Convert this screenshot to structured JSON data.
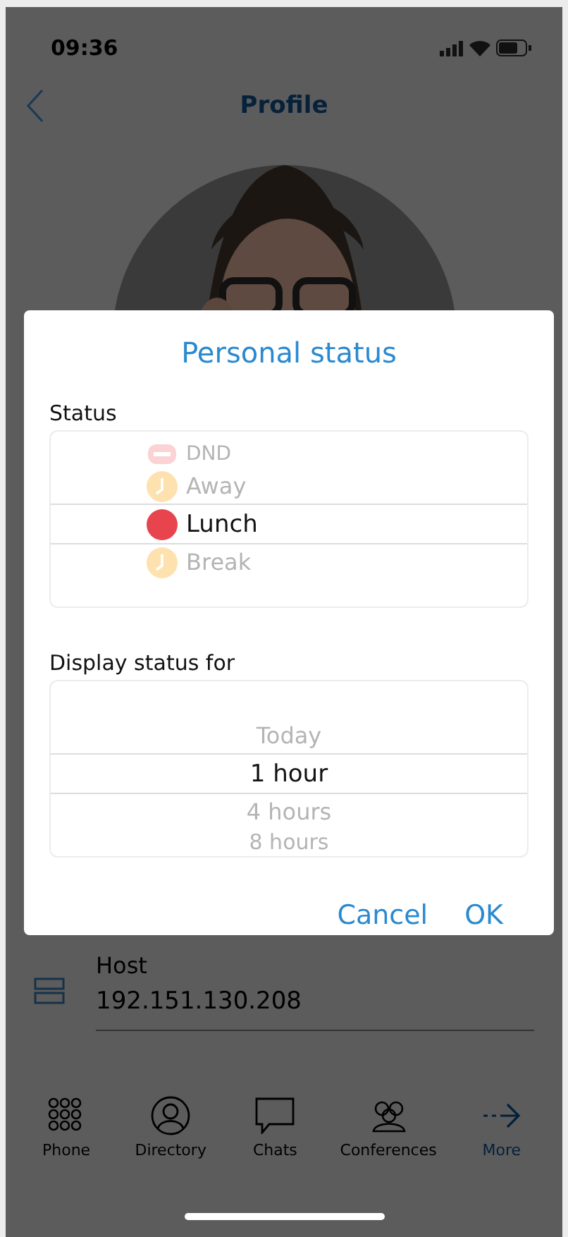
{
  "status_bar": {
    "time": "09:36"
  },
  "nav": {
    "title": "Profile"
  },
  "dialog": {
    "title": "Personal status",
    "status_picker": {
      "label": "Status",
      "options": [
        {
          "label": "DND",
          "kind": "dnd",
          "color": "#fbd3d5",
          "selected": false
        },
        {
          "label": "Away",
          "kind": "clock",
          "color": "#fde2b0",
          "selected": false
        },
        {
          "label": "Lunch",
          "kind": "dot",
          "color": "#e8444e",
          "selected": true
        },
        {
          "label": "Break",
          "kind": "clock",
          "color": "#fde2b0",
          "selected": false
        }
      ]
    },
    "duration_picker": {
      "label": "Display status for",
      "options": [
        {
          "label": "Today",
          "selected": false
        },
        {
          "label": "1 hour",
          "selected": true
        },
        {
          "label": "4 hours",
          "selected": false
        },
        {
          "label": "8 hours",
          "selected": false
        }
      ]
    },
    "buttons": [
      "Cancel",
      "OK"
    ]
  },
  "host": {
    "label": "Host",
    "value": "192.151.130.208"
  },
  "tabs": [
    {
      "label": "Phone",
      "kind": "dialpad",
      "selected": false
    },
    {
      "label": "Directory",
      "kind": "person",
      "selected": false
    },
    {
      "label": "Chats",
      "kind": "chat",
      "selected": false
    },
    {
      "label": "Conferences",
      "kind": "group",
      "selected": false
    },
    {
      "label": "More",
      "kind": "arrow",
      "selected": true
    }
  ]
}
